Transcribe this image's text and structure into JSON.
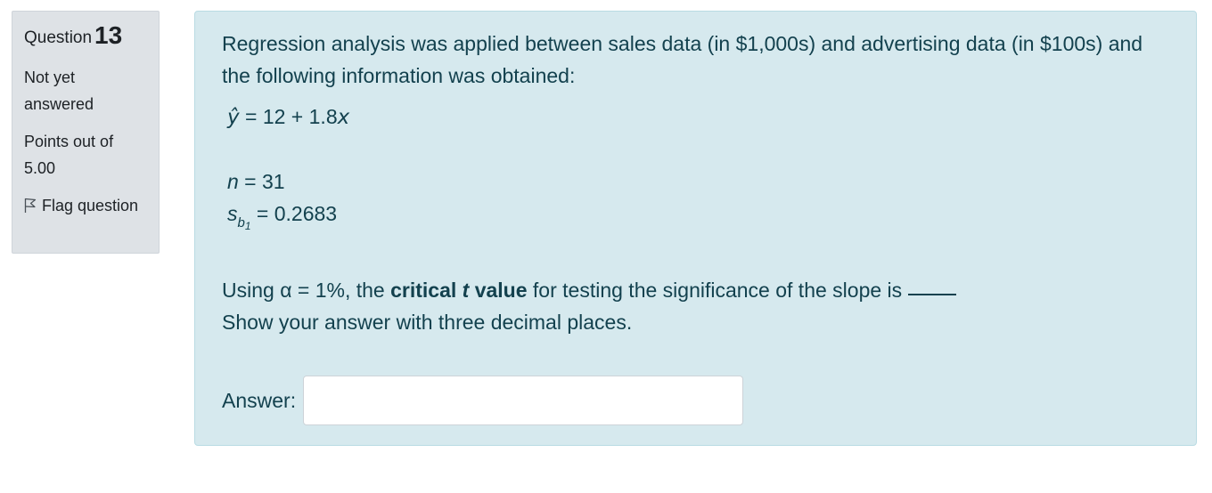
{
  "info": {
    "question_label": "Question",
    "question_number": "13",
    "state": "Not yet answered",
    "grade": "Points out of 5.00",
    "flag_label": "Flag question",
    "flag_icon": "flag-outline-icon"
  },
  "question": {
    "intro": "Regression analysis was applied between sales data (in $1,000s) and advertising data (in $100s) and the following information was obtained:",
    "equation_lhs": "ŷ",
    "equation_rhs": " = 12 + 1.8",
    "equation_var": "x",
    "n_var": "n",
    "n_value": " = 31",
    "sb_symbol": "s",
    "sb_sub": "b",
    "sb_subsub": "1",
    "sb_value": " = 0.2683",
    "prompt_pre": "Using α = 1%, the ",
    "prompt_bold": "critical ",
    "prompt_bold_italic": "t",
    "prompt_bold_after": " value",
    "prompt_post": " for testing the significance of the slope is ",
    "instruction": "Show your answer with three decimal places.",
    "answer_label": "Answer:",
    "answer_value": ""
  },
  "colors": {
    "info_bg": "#dee2e6",
    "content_bg": "#d6e9ee",
    "content_text": "#13414e"
  }
}
